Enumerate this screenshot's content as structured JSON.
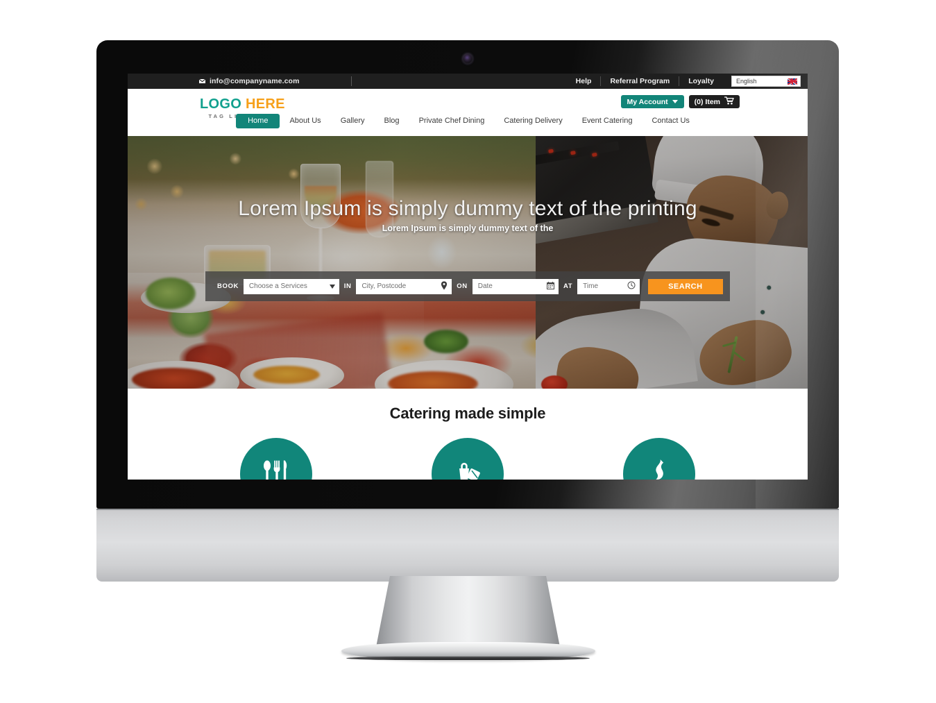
{
  "device": {
    "type": "desktop-monitor",
    "webcam": "camera-icon"
  },
  "topbar": {
    "email": "info@companyname.com",
    "email_icon": "envelope-icon",
    "links": [
      "Help",
      "Referral Program",
      "Loyalty"
    ],
    "language": {
      "value": "English",
      "flag": "uk-flag-icon"
    }
  },
  "logo": {
    "primary": "LOGO",
    "accent": "HERE",
    "tagline": "TAG LINE HERE"
  },
  "account": {
    "my_account_label": "My Account",
    "cart_label": "(0) Item",
    "cart_icon": "shopping-cart-icon",
    "caret_icon": "chevron-down-icon"
  },
  "nav": {
    "items": [
      {
        "label": "Home",
        "active": true
      },
      {
        "label": "About Us",
        "active": false
      },
      {
        "label": "Gallery",
        "active": false
      },
      {
        "label": "Blog",
        "active": false
      },
      {
        "label": "Private Chef Dining",
        "active": false
      },
      {
        "label": "Catering Delivery",
        "active": false
      },
      {
        "label": "Event Catering",
        "active": false
      },
      {
        "label": "Contact Us",
        "active": false
      }
    ]
  },
  "hero": {
    "title": "Lorem Ipsum is simply dummy text of the printing",
    "subtitle": "Lorem Ipsum is simply dummy text of the"
  },
  "search": {
    "book_label": "BOOK",
    "in_label": "IN",
    "on_label": "ON",
    "at_label": "AT",
    "service_placeholder": "Choose a Services",
    "city_placeholder": "City, Postcode",
    "date_placeholder": "Date",
    "time_placeholder": "Time",
    "button_label": "SEARCH",
    "city_icon": "map-pin-icon",
    "date_icon": "calendar-icon",
    "time_icon": "clock-icon",
    "service_icon": "chevron-down-icon"
  },
  "features": {
    "heading": "Catering made simple",
    "items": [
      {
        "icon": "cutlery-icon"
      },
      {
        "icon": "delivery-bag-icon"
      },
      {
        "icon": "flame-icon"
      }
    ]
  },
  "colors": {
    "teal": "#11867a",
    "orange_accent": "#f6a01a",
    "search_button": "#f7941e",
    "topbar_bg": "#1f1f1f"
  }
}
